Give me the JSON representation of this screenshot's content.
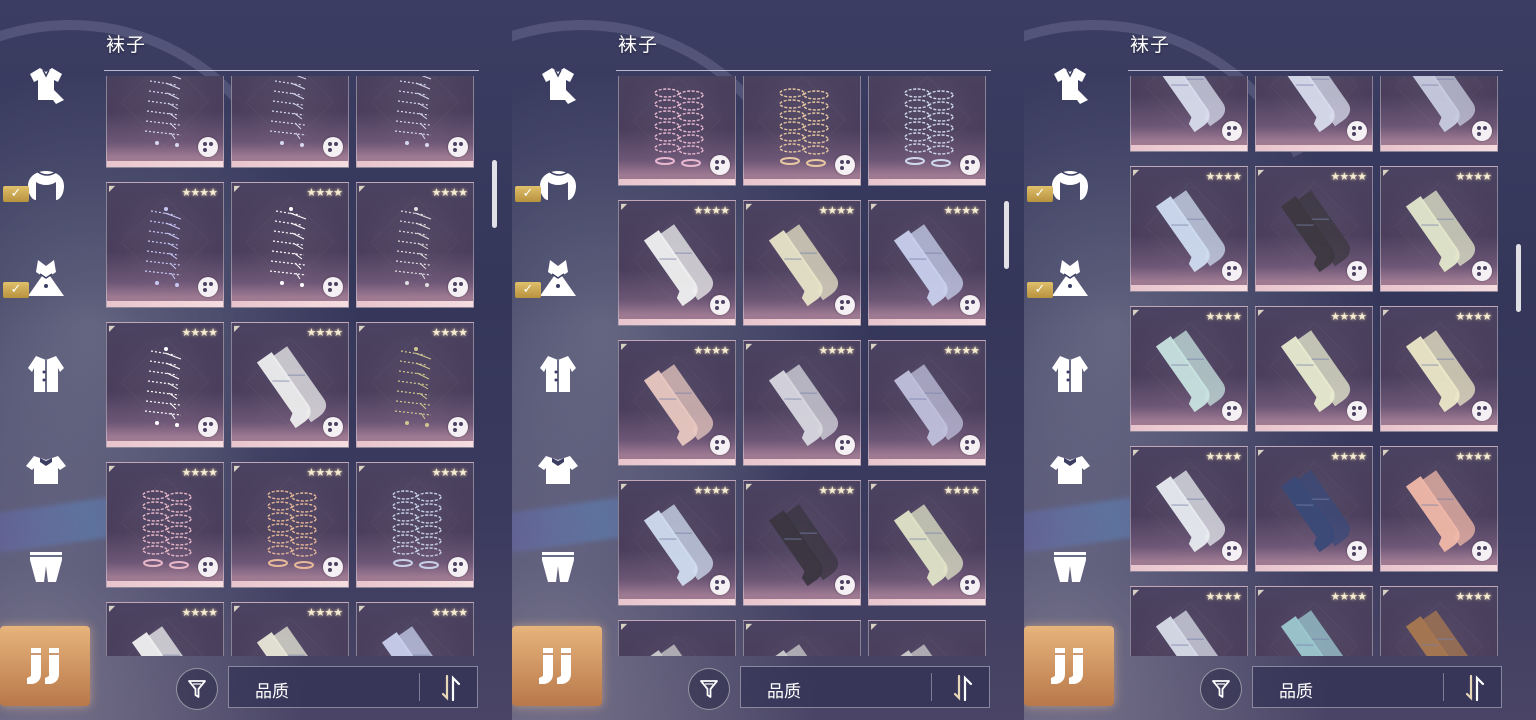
{
  "category_title": "袜子",
  "sort_label": "品质",
  "stars": "★★★★",
  "sidebar": [
    {
      "name": "outfit-icon",
      "checked": false
    },
    {
      "name": "hair-icon",
      "checked": true
    },
    {
      "name": "dress-icon",
      "checked": true
    },
    {
      "name": "coat-icon",
      "checked": false
    },
    {
      "name": "top-icon",
      "checked": false
    },
    {
      "name": "bottom-icon",
      "checked": false
    },
    {
      "name": "socks-icon",
      "checked": false,
      "active": true
    }
  ],
  "panels": [
    {
      "scroll": 0.25,
      "offset": 34,
      "items": [
        {
          "kind": "chain",
          "color": "#d8d8f0",
          "stars": false
        },
        {
          "kind": "chain",
          "color": "#d8d8f0",
          "stars": false
        },
        {
          "kind": "chain",
          "color": "#d8d8f0",
          "stars": false
        },
        {
          "kind": "chain",
          "color": "#c8c8f4",
          "stars": true
        },
        {
          "kind": "chain",
          "color": "#ffffff",
          "stars": true
        },
        {
          "kind": "chain",
          "color": "#e0e0e0",
          "stars": true
        },
        {
          "kind": "chain",
          "color": "#ffffff",
          "stars": true
        },
        {
          "kind": "sock",
          "color": "#eeeeee",
          "stars": true
        },
        {
          "kind": "chain",
          "color": "#d0c890",
          "stars": true
        },
        {
          "kind": "ring",
          "color": "#e8b8c8",
          "stars": true
        },
        {
          "kind": "ring",
          "color": "#e8b898",
          "stars": true
        },
        {
          "kind": "ring",
          "color": "#c8d0e8",
          "stars": true
        },
        {
          "kind": "sock",
          "color": "#f0f0f0",
          "stars": true
        },
        {
          "kind": "sock",
          "color": "#e8e8d8",
          "stars": true
        },
        {
          "kind": "sock",
          "color": "#c8d0ec",
          "stars": true
        }
      ]
    },
    {
      "scroll": 0.42,
      "offset": 16,
      "items": [
        {
          "kind": "ring",
          "color": "#e8b8d0",
          "stars": false
        },
        {
          "kind": "ring",
          "color": "#e8c8a0",
          "stars": false
        },
        {
          "kind": "ring",
          "color": "#d0d8ec",
          "stars": false
        },
        {
          "kind": "sock",
          "color": "#f0f0f0",
          "stars": true
        },
        {
          "kind": "sock",
          "color": "#e8e4c8",
          "stars": true
        },
        {
          "kind": "sock",
          "color": "#c8d0ec",
          "stars": true
        },
        {
          "kind": "sock",
          "color": "#e8c8c0",
          "stars": true
        },
        {
          "kind": "sock",
          "color": "#d8d8e0",
          "stars": true
        },
        {
          "kind": "sock",
          "color": "#c0c0dc",
          "stars": true
        },
        {
          "kind": "sock",
          "color": "#d0dcf0",
          "stars": true
        },
        {
          "kind": "sock",
          "color": "#3a3640",
          "stars": true
        },
        {
          "kind": "sock",
          "color": "#e0e4c8",
          "stars": true
        },
        {
          "kind": "sock",
          "color": "#cccccc",
          "stars": false
        },
        {
          "kind": "sock",
          "color": "#cccccc",
          "stars": false
        },
        {
          "kind": "sock",
          "color": "#cccccc",
          "stars": false
        }
      ]
    },
    {
      "scroll": 0.6,
      "offset": 50,
      "items": [
        {
          "kind": "sock",
          "color": "#d8dcec",
          "stars": false
        },
        {
          "kind": "sock",
          "color": "#d8dcec",
          "stars": false
        },
        {
          "kind": "sock",
          "color": "#c8cce0",
          "stars": false
        },
        {
          "kind": "sock",
          "color": "#cfdcf0",
          "stars": true
        },
        {
          "kind": "sock",
          "color": "#3c3840",
          "stars": true
        },
        {
          "kind": "sock",
          "color": "#e4e8cc",
          "stars": true
        },
        {
          "kind": "sock",
          "color": "#c8e4e0",
          "stars": true
        },
        {
          "kind": "sock",
          "color": "#e8ecd0",
          "stars": true
        },
        {
          "kind": "sock",
          "color": "#ece8c8",
          "stars": true
        },
        {
          "kind": "sock",
          "color": "#e8ecf0",
          "stars": true
        },
        {
          "kind": "sock",
          "color": "#3a4a78",
          "stars": true
        },
        {
          "kind": "sock",
          "color": "#f0b8a8",
          "stars": true
        },
        {
          "kind": "sock",
          "color": "#d8dce8",
          "stars": true
        },
        {
          "kind": "sock",
          "color": "#9cc8d0",
          "stars": true
        },
        {
          "kind": "sock",
          "color": "#a87850",
          "stars": true
        }
      ]
    }
  ]
}
